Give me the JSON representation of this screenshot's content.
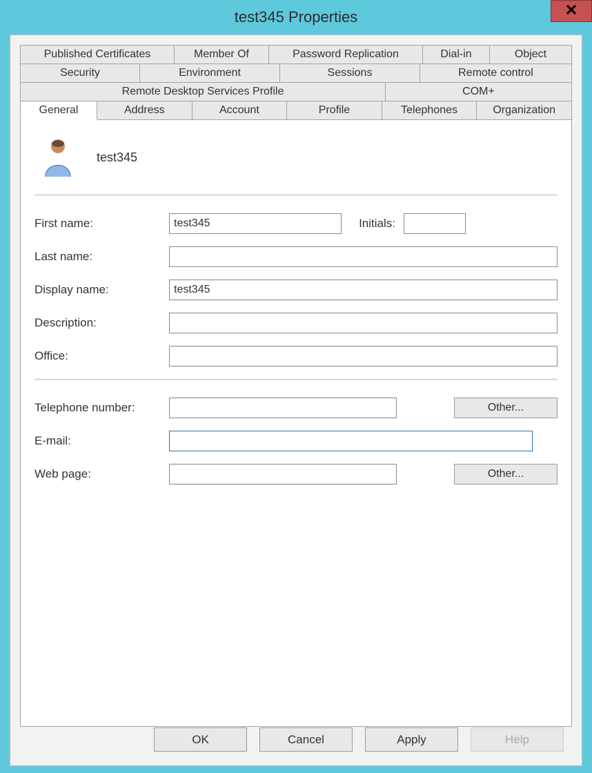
{
  "window": {
    "title": "test345 Properties"
  },
  "tabs": {
    "row1": [
      "Published Certificates",
      "Member Of",
      "Password Replication",
      "Dial-in",
      "Object"
    ],
    "row2": [
      "Security",
      "Environment",
      "Sessions",
      "Remote control"
    ],
    "row3": [
      "Remote Desktop Services Profile",
      "COM+"
    ],
    "row4": [
      "General",
      "Address",
      "Account",
      "Profile",
      "Telephones",
      "Organization"
    ],
    "active": "General"
  },
  "general": {
    "username": "test345",
    "labels": {
      "first_name": "First name:",
      "initials": "Initials:",
      "last_name": "Last name:",
      "display_name": "Display name:",
      "description": "Description:",
      "office": "Office:",
      "telephone": "Telephone number:",
      "email": "E-mail:",
      "webpage": "Web page:"
    },
    "values": {
      "first_name": "test345",
      "initials": "",
      "last_name": "",
      "display_name": "test345",
      "description": "",
      "office": "",
      "telephone": "",
      "email": "",
      "webpage": ""
    },
    "other_button": "Other..."
  },
  "buttons": {
    "ok": "OK",
    "cancel": "Cancel",
    "apply": "Apply",
    "help": "Help"
  }
}
